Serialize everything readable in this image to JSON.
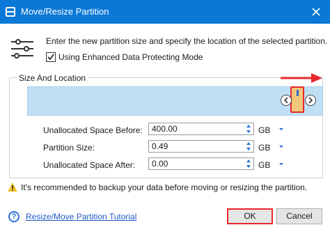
{
  "window": {
    "title": "Move/Resize Partition"
  },
  "intro": {
    "text": "Enter the new partition size and specify the location of the selected partition.",
    "checkbox_label": "Using Enhanced Data Protecting Mode",
    "checkbox_checked": true
  },
  "group": {
    "legend": "Size And Location"
  },
  "fields": [
    {
      "label": "Unallocated Space Before:",
      "value": "400.00",
      "unit": "GB"
    },
    {
      "label": "Partition Size:",
      "value": "0.49",
      "unit": "GB"
    },
    {
      "label": "Unallocated Space After:",
      "value": "0.00",
      "unit": "GB"
    }
  ],
  "warning": {
    "text": "It's recommended to backup your data before moving or resizing the partition."
  },
  "footer": {
    "help_link": "Resize/Move Partition Tutorial",
    "ok_label": "OK",
    "cancel_label": "Cancel"
  },
  "colors": {
    "titlebar": "#0a78d7",
    "partition_bar": "#bfe0f4",
    "slider_region": "#f2c77a",
    "annotation": "#e8272c"
  },
  "icons": {
    "app": "app-icon",
    "close": "close-icon",
    "settings": "sliders-icon",
    "checkbox": "checkmark-icon",
    "nav_left": "chevron-left-icon",
    "nav_right": "chevron-right-icon",
    "warning": "warning-icon",
    "help": "help-icon"
  }
}
